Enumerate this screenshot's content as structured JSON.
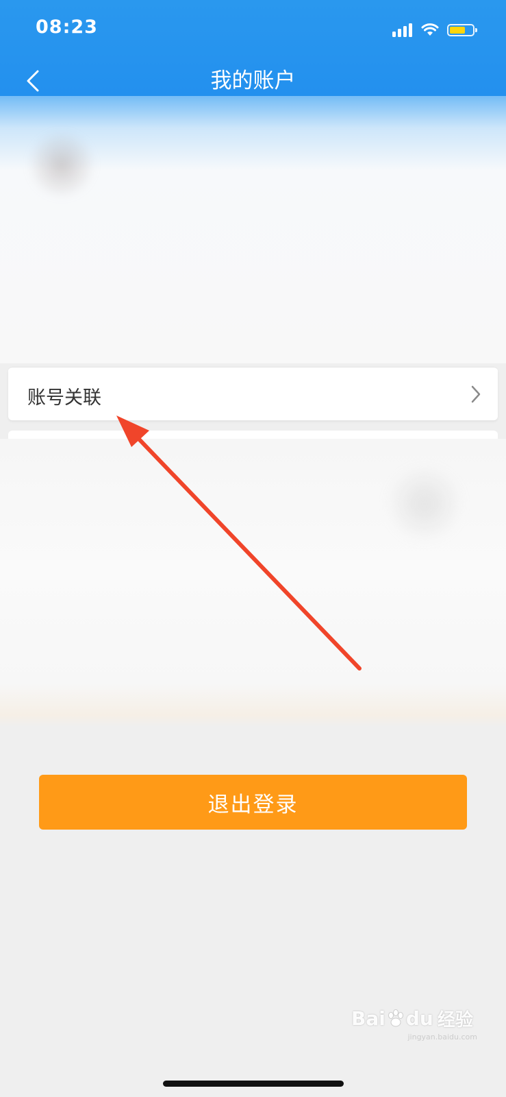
{
  "status_bar": {
    "time": "08:23"
  },
  "header": {
    "title": "我的账户",
    "back_icon": "chevron-left-icon"
  },
  "account_link": {
    "label": "账号关联",
    "chevron_icon": "chevron-right-icon"
  },
  "logout": {
    "label": "退出登录"
  },
  "watermark": {
    "brand": "Bai",
    "brand2": "du",
    "suffix": "经验",
    "url": "jingyan.baidu.com"
  },
  "colors": {
    "header_blue": "#2390ee",
    "logout_orange": "#ff9a17",
    "annotation_red": "#f0452a"
  }
}
